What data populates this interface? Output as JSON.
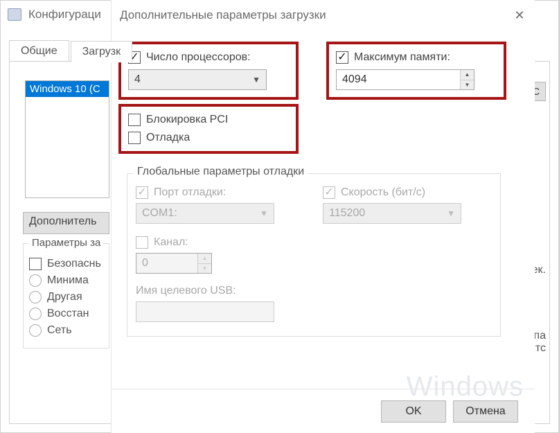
{
  "parent": {
    "title": "Конфигураци",
    "tabs": {
      "general": "Общие",
      "boot": "Загрузк"
    },
    "os_list": {
      "item": "Windows 10 (C"
    },
    "btn_os": "ОС",
    "btn_advanced": "Дополнитель",
    "safeboot": {
      "group_label": "Параметры за",
      "safe": "Безопаснь",
      "minimal": "Минима",
      "altshell": "Другая",
      "adrepair": "Восстан",
      "network": "Сеть"
    },
    "right": {
      "sec": "сек.",
      "frag": "ти па\nостс"
    }
  },
  "dialog": {
    "title": "Дополнительные параметры загрузки",
    "numproc": {
      "label": "Число процессоров:",
      "value": "4",
      "checked": true
    },
    "maxmem": {
      "label": "Максимум памяти:",
      "value": "4094",
      "checked": true
    },
    "pcilock": {
      "label": "Блокировка PCI",
      "checked": false
    },
    "debug": {
      "label": "Отладка",
      "checked": false
    },
    "global": {
      "group_label": "Глобальные параметры отладки",
      "port": {
        "label": "Порт отладки:",
        "value": "COM1:"
      },
      "baud": {
        "label": "Скорость (бит/с)",
        "value": "115200"
      },
      "channel": {
        "label": "Канал:",
        "value": "0"
      },
      "usb": {
        "label": "Имя целевого USB:"
      }
    },
    "buttons": {
      "ok": "OK",
      "cancel": "Отмена"
    }
  },
  "watermark": "Windows"
}
